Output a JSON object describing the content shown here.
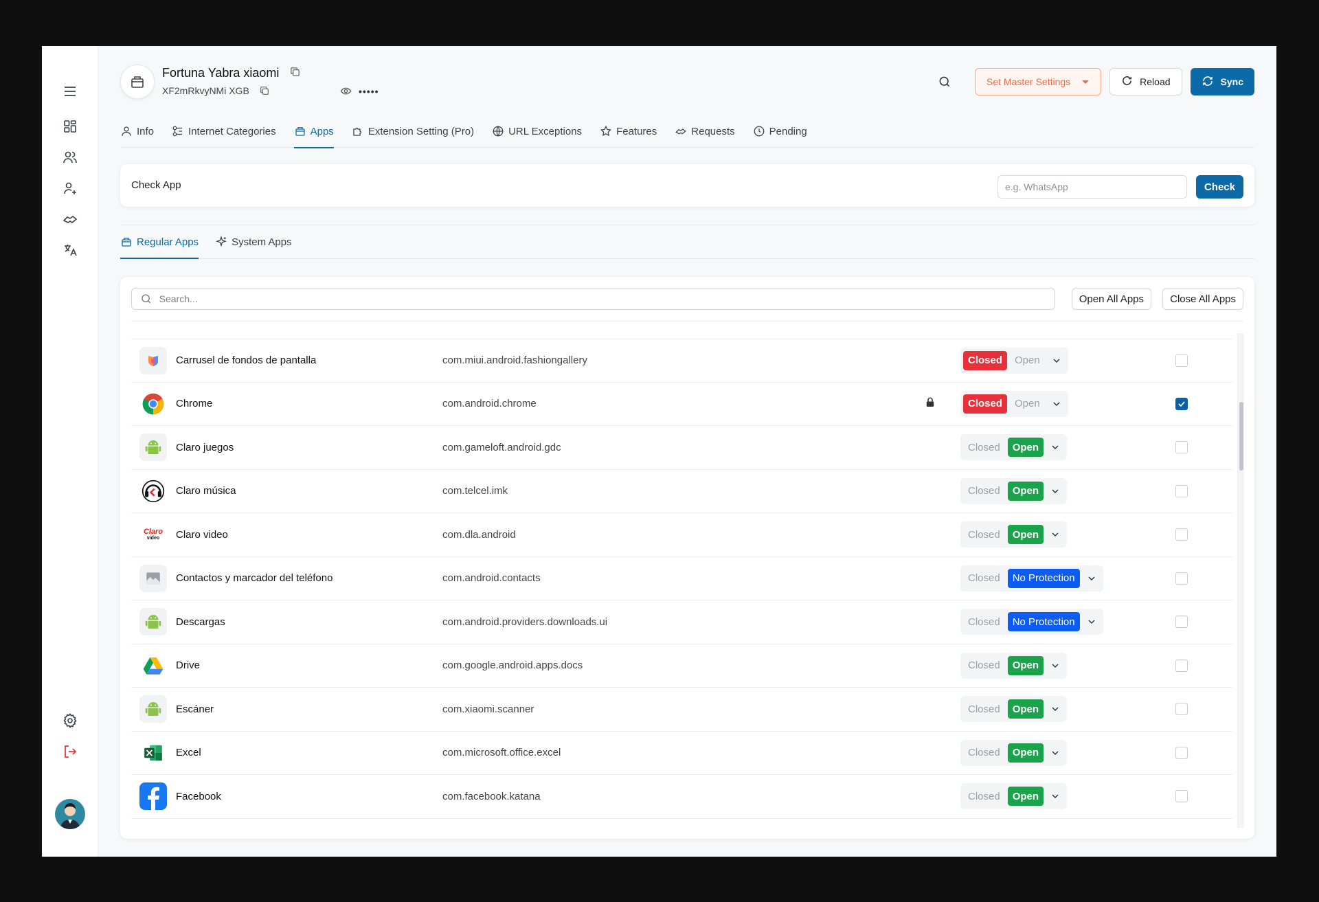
{
  "device": {
    "title": "Fortuna Yabra xiaomi",
    "subtitle": "XF2mRkvyNMi XGB",
    "masked": "•••••"
  },
  "header": {
    "master_label": "Set Master Settings",
    "reload_label": "Reload",
    "sync_label": "Sync"
  },
  "tabs": [
    {
      "label": "Info"
    },
    {
      "label": "Internet Categories"
    },
    {
      "label": "Apps"
    },
    {
      "label": "Extension Setting (Pro)"
    },
    {
      "label": "URL Exceptions"
    },
    {
      "label": "Features"
    },
    {
      "label": "Requests"
    },
    {
      "label": "Pending"
    }
  ],
  "check_app": {
    "label": "Check App",
    "placeholder": "e.g. WhatsApp",
    "button": "Check"
  },
  "subtabs": [
    {
      "label": "Regular Apps"
    },
    {
      "label": "System Apps"
    }
  ],
  "list_controls": {
    "search_placeholder": "Search...",
    "open_all": "Open All Apps",
    "close_all": "Close All Apps"
  },
  "toggle_labels": {
    "closed": "Closed",
    "open": "Open",
    "no_protection": "No Protection"
  },
  "apps": [
    {
      "name": "Carrusel de fondos de pantalla",
      "package": "com.miui.android.fashiongallery",
      "state": "closed",
      "locked": false,
      "checked": false,
      "icon": "wallpaper-carousel-icon"
    },
    {
      "name": "Chrome",
      "package": "com.android.chrome",
      "state": "closed",
      "locked": true,
      "checked": true,
      "icon": "chrome-icon"
    },
    {
      "name": "Claro juegos",
      "package": "com.gameloft.android.gdc",
      "state": "open",
      "locked": false,
      "checked": false,
      "icon": "android-icon"
    },
    {
      "name": "Claro música",
      "package": "com.telcel.imk",
      "state": "open",
      "locked": false,
      "checked": false,
      "icon": "claro-musica-icon"
    },
    {
      "name": "Claro video",
      "package": "com.dla.android",
      "state": "open",
      "locked": false,
      "checked": false,
      "icon": "claro-video-icon"
    },
    {
      "name": "Contactos y marcador del teléfono",
      "package": "com.android.contacts",
      "state": "no_protection",
      "locked": false,
      "checked": false,
      "icon": "image-placeholder-icon"
    },
    {
      "name": "Descargas",
      "package": "com.android.providers.downloads.ui",
      "state": "no_protection",
      "locked": false,
      "checked": false,
      "icon": "android-icon"
    },
    {
      "name": "Drive",
      "package": "com.google.android.apps.docs",
      "state": "open",
      "locked": false,
      "checked": false,
      "icon": "google-drive-icon"
    },
    {
      "name": "Escáner",
      "package": "com.xiaomi.scanner",
      "state": "open",
      "locked": false,
      "checked": false,
      "icon": "android-icon"
    },
    {
      "name": "Excel",
      "package": "com.microsoft.office.excel",
      "state": "open",
      "locked": false,
      "checked": false,
      "icon": "excel-icon"
    },
    {
      "name": "Facebook",
      "package": "com.facebook.katana",
      "state": "open",
      "locked": false,
      "checked": false,
      "icon": "facebook-icon"
    }
  ],
  "colors": {
    "primary": "#0b6aa7",
    "closed_red": "#e6313b",
    "open_green": "#1aa34a",
    "no_protection_blue": "#0d5cf2",
    "master_orange": "#f06a43"
  }
}
